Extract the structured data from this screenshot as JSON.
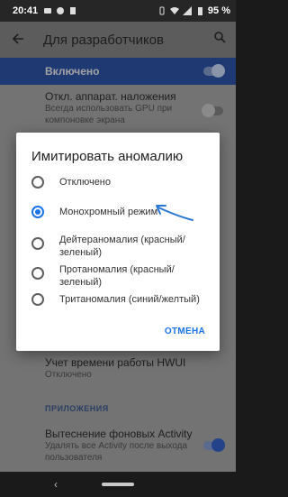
{
  "status_bar": {
    "time": "20:41",
    "battery": "95 %"
  },
  "app_bar": {
    "title": "Для разработчиков"
  },
  "enabled": {
    "label": "Включено"
  },
  "bg_items": [
    {
      "title": "Откл. аппарат. наложения",
      "summary": "Всегда использовать GPU при компоновке экрана"
    },
    {
      "title": "Учет времени работы HWUI",
      "summary": "Отключено"
    }
  ],
  "section": {
    "apps": "ПРИЛОЖЕНИЯ"
  },
  "bg_item_bottom": {
    "title": "Вытеснение фоновых Activity",
    "summary": "Удалять все Activity после выхода пользователя"
  },
  "dialog": {
    "title": "Имитировать аномалию",
    "options": [
      {
        "label": "Отключено",
        "selected": false
      },
      {
        "label": "Монохромный режим",
        "selected": true
      },
      {
        "label": "Дейтераномалия (красный/ зеленый)",
        "selected": false
      },
      {
        "label": "Протаномалия (красный/ зеленый)",
        "selected": false
      },
      {
        "label": "Тританомалия (синий/желтый)",
        "selected": false
      }
    ],
    "cancel_label": "ОТМЕНА"
  },
  "colors": {
    "accent": "#1a73e8",
    "scrim": "#737373"
  },
  "icons": [
    "back-arrow-icon",
    "search-icon",
    "wifi-icon",
    "signal-icon",
    "battery-icon",
    "annotation-arrow-icon"
  ]
}
